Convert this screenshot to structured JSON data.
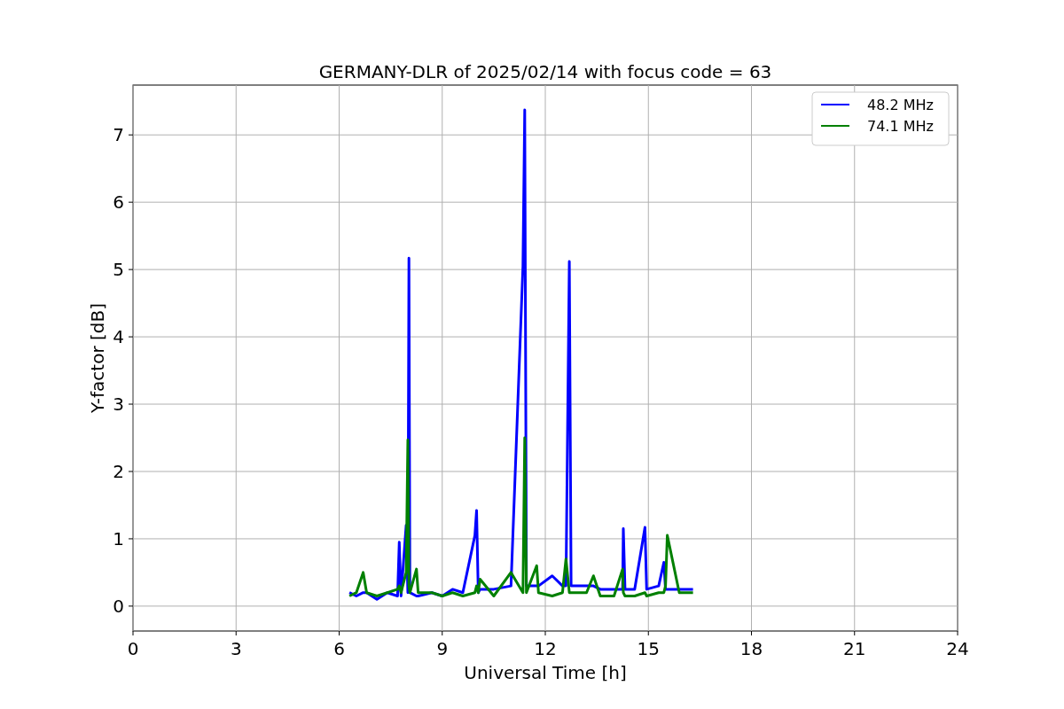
{
  "chart_data": {
    "type": "line",
    "title": "GERMANY-DLR of 2025/02/14 with focus code = 63",
    "xlabel": "Universal Time [h]",
    "ylabel": "Y-factor [dB]",
    "x": [
      6.3,
      6.5,
      6.7,
      6.8,
      7.1,
      7.4,
      7.7,
      7.75,
      7.8,
      7.95,
      8.0,
      8.03,
      8.06,
      8.25,
      8.3,
      8.7,
      9.0,
      9.3,
      9.6,
      9.95,
      10.0,
      10.05,
      10.1,
      10.5,
      11.0,
      11.35,
      11.4,
      11.45,
      11.75,
      11.8,
      12.2,
      12.5,
      12.6,
      12.7,
      12.75,
      13.2,
      13.4,
      13.6,
      14.0,
      14.25,
      14.27,
      14.32,
      14.6,
      14.9,
      14.95,
      15.3,
      15.45,
      15.5,
      15.55,
      15.9,
      16.3
    ],
    "series": [
      {
        "name": "48.2 MHz",
        "color": "#0000ff",
        "values": [
          0.2,
          0.15,
          0.2,
          0.2,
          0.1,
          0.2,
          0.15,
          0.95,
          0.15,
          1.2,
          0.2,
          5.17,
          0.2,
          0.15,
          0.15,
          0.2,
          0.15,
          0.25,
          0.2,
          1.05,
          1.42,
          0.2,
          0.25,
          0.25,
          0.3,
          5.05,
          7.37,
          0.3,
          0.3,
          0.3,
          0.45,
          0.3,
          0.3,
          5.12,
          0.3,
          0.3,
          0.3,
          0.25,
          0.25,
          0.25,
          1.15,
          0.25,
          0.25,
          1.17,
          0.25,
          0.3,
          0.65,
          0.25,
          0.25,
          0.25,
          0.25
        ]
      },
      {
        "name": "74.1 MHz",
        "color": "#008000",
        "values": [
          0.15,
          0.2,
          0.5,
          0.2,
          0.15,
          0.2,
          0.25,
          0.3,
          0.2,
          0.5,
          2.47,
          0.3,
          0.2,
          0.55,
          0.2,
          0.2,
          0.15,
          0.2,
          0.15,
          0.2,
          0.3,
          0.2,
          0.4,
          0.15,
          0.5,
          0.2,
          2.5,
          0.2,
          0.6,
          0.2,
          0.15,
          0.2,
          0.7,
          0.2,
          0.2,
          0.2,
          0.45,
          0.15,
          0.15,
          0.55,
          0.2,
          0.15,
          0.15,
          0.2,
          0.15,
          0.2,
          0.2,
          0.3,
          1.05,
          0.2,
          0.2
        ]
      }
    ],
    "xlim": [
      0,
      24
    ],
    "ylim": [
      -0.37,
      7.74
    ],
    "xticks": [
      0,
      3,
      6,
      9,
      12,
      15,
      18,
      21,
      24
    ],
    "yticks": [
      0,
      1,
      2,
      3,
      4,
      5,
      6,
      7
    ],
    "grid": true,
    "legend": true
  }
}
